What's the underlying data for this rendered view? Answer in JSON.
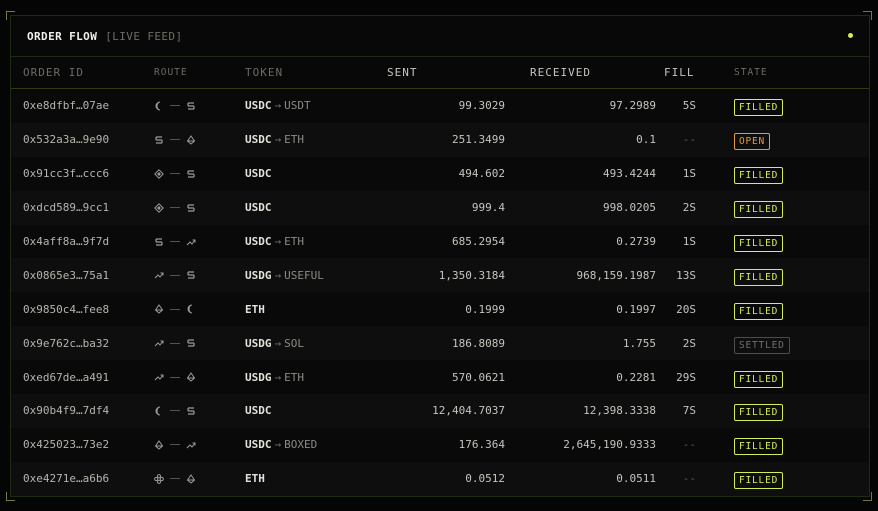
{
  "header": {
    "title": "ORDER FLOW",
    "subtitle": "[LIVE FEED]"
  },
  "columns": {
    "order_id": "ORDER ID",
    "route": "ROUTE",
    "token": "TOKEN",
    "sent": "SENT",
    "received": "RECEIVED",
    "fill": "FILL",
    "state": "STATE"
  },
  "colors": {
    "accent": "#d8ec5a",
    "open": "#e39a48",
    "settled": "#6e6e68"
  },
  "rows": [
    {
      "id": "0xe8dfbf…07ae",
      "route": [
        "moon-icon",
        "stack-icon"
      ],
      "from": "USDC",
      "to": "USDT",
      "sent": "99.3029",
      "received": "97.2989",
      "fill": "5S",
      "state": "FILLED"
    },
    {
      "id": "0x532a3a…9e90",
      "route": [
        "stack-icon",
        "drop-icon"
      ],
      "from": "USDC",
      "to": "ETH",
      "sent": "251.3499",
      "received": "0.1",
      "fill": "--",
      "state": "OPEN"
    },
    {
      "id": "0x91cc3f…ccc6",
      "route": [
        "diamond-icon",
        "stack-icon"
      ],
      "from": "USDC",
      "to": "",
      "sent": "494.602",
      "received": "493.4244",
      "fill": "1S",
      "state": "FILLED"
    },
    {
      "id": "0xdcd589…9cc1",
      "route": [
        "diamond-icon",
        "stack-icon"
      ],
      "from": "USDC",
      "to": "",
      "sent": "999.4",
      "received": "998.0205",
      "fill": "2S",
      "state": "FILLED"
    },
    {
      "id": "0x4aff8a…9f7d",
      "route": [
        "stack-icon",
        "trend-icon"
      ],
      "from": "USDC",
      "to": "ETH",
      "sent": "685.2954",
      "received": "0.2739",
      "fill": "1S",
      "state": "FILLED"
    },
    {
      "id": "0x0865e3…75a1",
      "route": [
        "trend-icon",
        "stack-icon"
      ],
      "from": "USDG",
      "to": "USEFUL",
      "sent": "1,350.3184",
      "received": "968,159.1987",
      "fill": "13S",
      "state": "FILLED"
    },
    {
      "id": "0x9850c4…fee8",
      "route": [
        "drop-icon",
        "moon-icon"
      ],
      "from": "ETH",
      "to": "",
      "sent": "0.1999",
      "received": "0.1997",
      "fill": "20S",
      "state": "FILLED"
    },
    {
      "id": "0x9e762c…ba32",
      "route": [
        "trend-icon",
        "stack-icon"
      ],
      "from": "USDG",
      "to": "SOL",
      "sent": "186.8089",
      "received": "1.755",
      "fill": "2S",
      "state": "SETTLED"
    },
    {
      "id": "0xed67de…a491",
      "route": [
        "trend-icon",
        "drop-icon"
      ],
      "from": "USDG",
      "to": "ETH",
      "sent": "570.0621",
      "received": "0.2281",
      "fill": "29S",
      "state": "FILLED"
    },
    {
      "id": "0x90b4f9…7df4",
      "route": [
        "moon-icon",
        "stack-icon"
      ],
      "from": "USDC",
      "to": "",
      "sent": "12,404.7037",
      "received": "12,398.3338",
      "fill": "7S",
      "state": "FILLED"
    },
    {
      "id": "0x425023…73e2",
      "route": [
        "drop-icon",
        "trend-icon"
      ],
      "from": "USDC",
      "to": "BOXED",
      "sent": "176.364",
      "received": "2,645,190.9333",
      "fill": "--",
      "state": "FILLED"
    },
    {
      "id": "0xe4271e…a6b6",
      "route": [
        "cross-icon",
        "drop-icon"
      ],
      "from": "ETH",
      "to": "",
      "sent": "0.0512",
      "received": "0.0511",
      "fill": "--",
      "state": "FILLED"
    }
  ]
}
